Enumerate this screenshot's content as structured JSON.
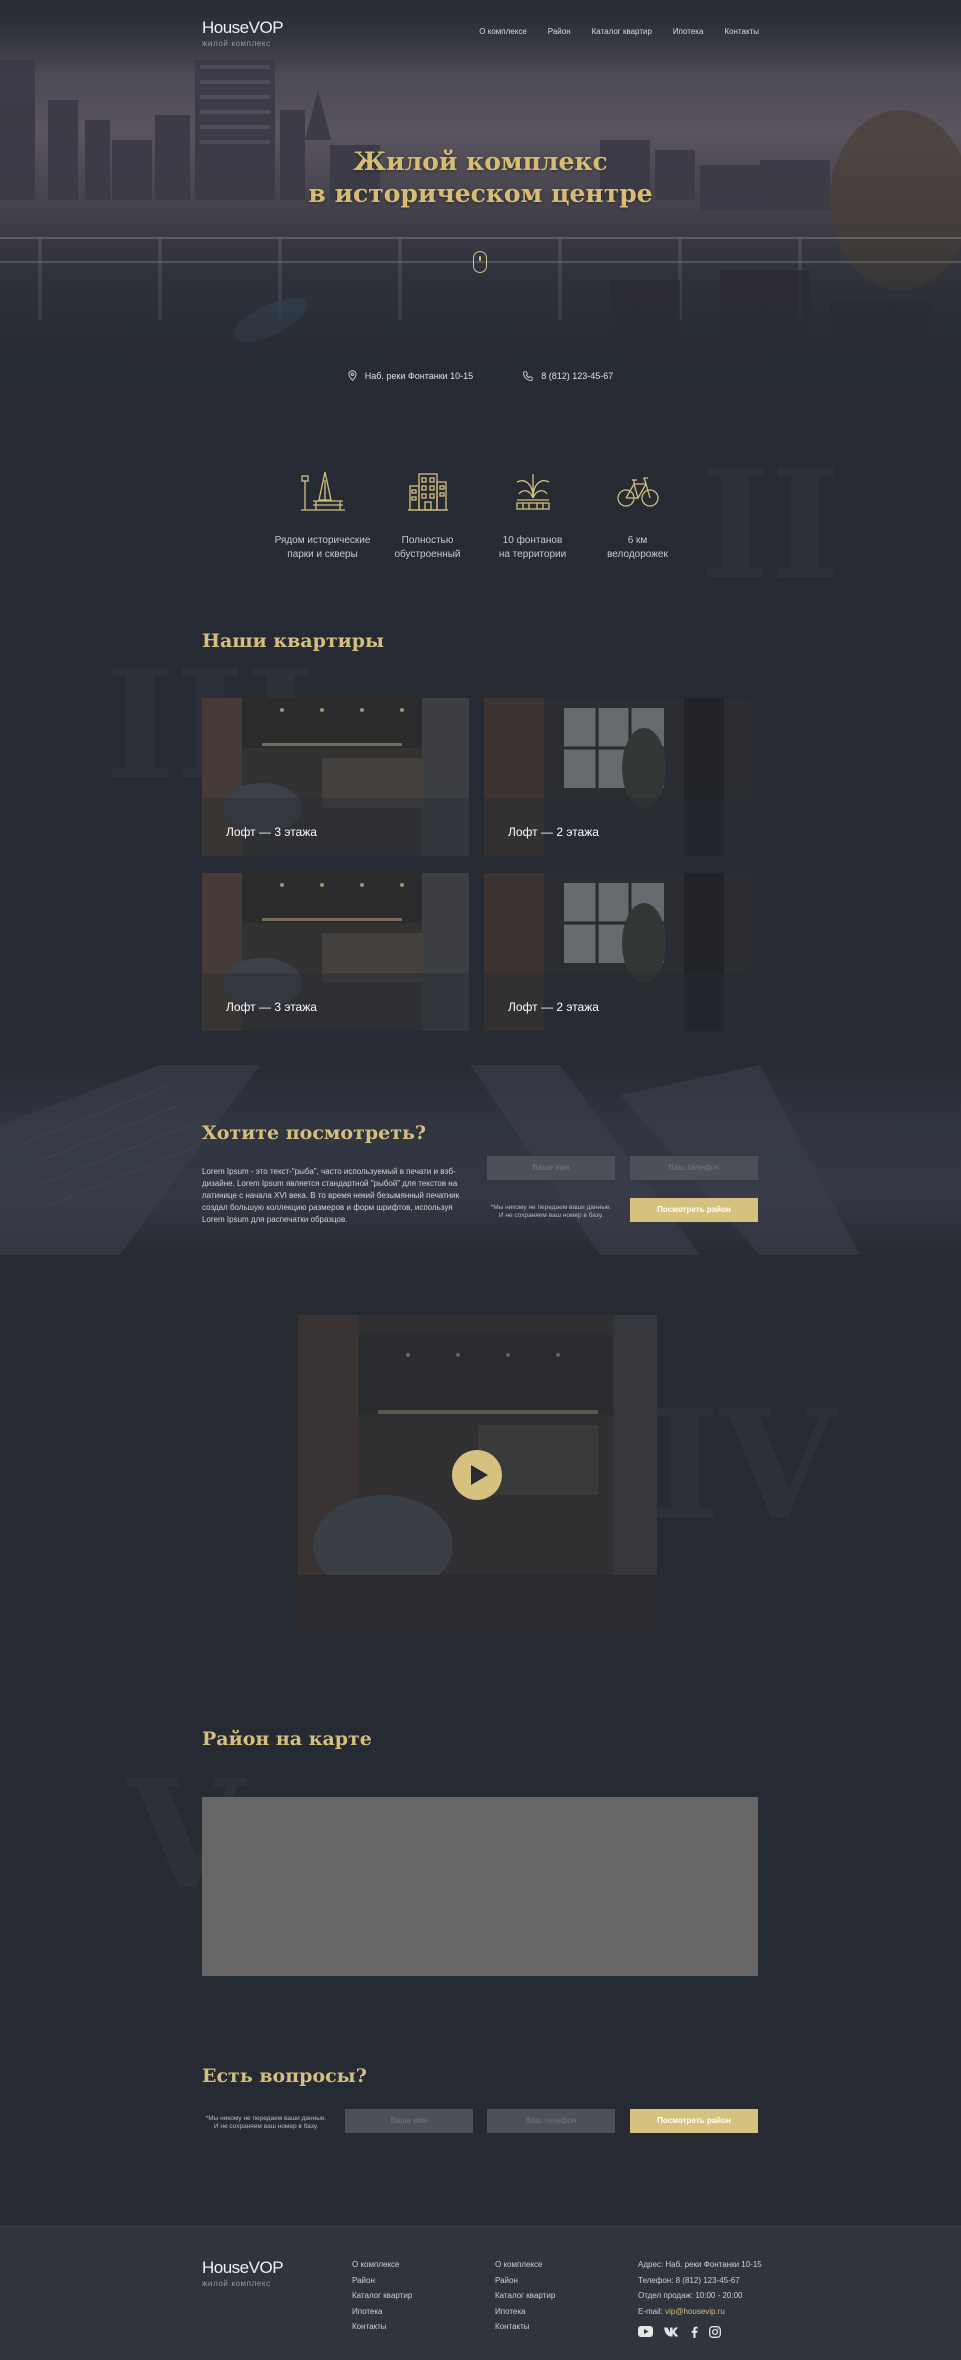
{
  "header": {
    "logo_name": "HouseVOP",
    "logo_sub": "жилой комплекс",
    "nav": [
      "О комплексе",
      "Район",
      "Каталог квартир",
      "Ипотека",
      "Контакты"
    ]
  },
  "hero": {
    "title_line1": "Жилой комплекс",
    "title_line2": "в историческом центре",
    "address": "Наб. реки Фонтанки 10-15",
    "phone": "8 (812) 123-45-67"
  },
  "numerals": [
    "II",
    "III",
    "IV",
    "V"
  ],
  "features": [
    {
      "icon": "park-bench-icon",
      "line1": "Рядом исторические",
      "line2": "парки и скверы"
    },
    {
      "icon": "building-icon",
      "line1": "Полностью",
      "line2": "обустроенный"
    },
    {
      "icon": "fountain-icon",
      "line1": "10 фонтанов",
      "line2": "на территории"
    },
    {
      "icon": "bicycle-icon",
      "line1": "6 км",
      "line2": "велодорожек"
    }
  ],
  "apartments": {
    "title": "Наши квартиры",
    "cards": [
      {
        "label": "Лофт — 3 этажа"
      },
      {
        "label": "Лофт — 2 этажа"
      },
      {
        "label": "Лофт — 3 этажа"
      },
      {
        "label": "Лофт — 2 этажа"
      }
    ]
  },
  "cta": {
    "title": "Хотите посмотреть?",
    "text": "Lorem Ipsum - это текст-\"рыба\", часто используемый в печати и вэб-дизайне. Lorem Ipsum является стандартной \"рыбой\" для текстов на латинице с начала XVI века. В то время некий безымянный печатник создал большую коллекцию размеров и форм шрифтов, используя Lorem Ipsum для распечатки образцов.",
    "name_placeholder": "Ваше имя",
    "phone_placeholder": "Ваш телефон",
    "privacy_line1": "*Мы никому не передаем ваши данные.",
    "privacy_line2": "И не сохраняем ваш номер в базу.",
    "button": "Посмотреть район"
  },
  "map": {
    "title": "Район на карте"
  },
  "questions": {
    "title": "Есть вопросы?",
    "privacy_line1": "*Мы никому не передаем ваши данные.",
    "privacy_line2": "И не сохраняем ваш номер в базу.",
    "name_placeholder": "Ваше имя",
    "phone_placeholder": "Ваш телефон",
    "button": "Посмотреть район"
  },
  "footer": {
    "logo_name": "HouseVOP",
    "logo_sub": "жилой комплекс",
    "col1": [
      "О комплексе",
      "Район",
      "Каталог квартир",
      "Ипотека",
      "Контакты"
    ],
    "col2": [
      "О комплексе",
      "Район",
      "Каталог квартир",
      "Ипотека",
      "Контакты"
    ],
    "address": "Адрес: Наб. реки Фонтанки 10-15",
    "phone": "Телефон: 8 (812) 123-45-67",
    "hours": "Отдел продаж: 10:00 - 20:00",
    "email_label": "E-mail:",
    "email": "vip@housevip.ru",
    "social": [
      "youtube-icon",
      "vk-icon",
      "facebook-icon",
      "instagram-icon"
    ]
  },
  "colors": {
    "background": "#262b33",
    "accent_gold": "#d4bf7f",
    "button_gold": "#d6c17e",
    "input": "#4c5059",
    "map_placeholder": "#666666",
    "footer": "#2f343d"
  }
}
